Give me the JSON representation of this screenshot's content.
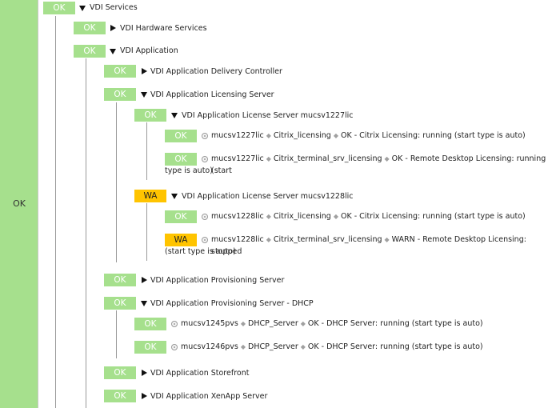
{
  "root": {
    "status": "OK"
  },
  "services": {
    "status": "OK",
    "label": "VDI Services",
    "hardware": {
      "status": "OK",
      "label": "VDI Hardware Services"
    },
    "application": {
      "status": "OK",
      "label": "VDI Application",
      "delivery_controller": {
        "status": "OK",
        "label": "VDI Application Delivery Controller"
      },
      "licensing": {
        "status": "OK",
        "label": "VDI Application Licensing Server",
        "server1": {
          "status": "OK",
          "label": "VDI Application License Server mucsv1227lic",
          "checks": [
            {
              "status": "OK",
              "host": "mucsv1227lic",
              "service": "Citrix_licensing",
              "text": "OK - Citrix Licensing: running (start type is auto)"
            },
            {
              "status": "OK",
              "host": "mucsv1227lic",
              "service": "Citrix_terminal_srv_licensing",
              "text": "OK - Remote Desktop Licensing: running (start",
              "text_cont": "type is auto)"
            }
          ]
        },
        "server2": {
          "status": "WA",
          "label": "VDI Application License Server mucsv1228lic",
          "checks": [
            {
              "status": "OK",
              "host": "mucsv1228lic",
              "service": "Citrix_licensing",
              "text": "OK - Citrix Licensing: running (start type is auto)"
            },
            {
              "status": "WA",
              "host": "mucsv1228lic",
              "service": "Citrix_terminal_srv_licensing",
              "text": "WARN - Remote Desktop Licensing: stopped",
              "text_cont": "(start type is auto)"
            }
          ]
        }
      },
      "provisioning": {
        "status": "OK",
        "label": "VDI Application Provisioning Server"
      },
      "provisioning_dhcp": {
        "status": "OK",
        "label": "VDI Application Provisioning Server - DHCP",
        "checks": [
          {
            "status": "OK",
            "host": "mucsv1245pvs",
            "service": "DHCP_Server",
            "text": "OK - DHCP Server: running (start type is auto)"
          },
          {
            "status": "OK",
            "host": "mucsv1246pvs",
            "service": "DHCP_Server",
            "text": "OK - DHCP Server: running (start type is auto)"
          }
        ]
      },
      "storefront": {
        "status": "OK",
        "label": "VDI Application Storefront"
      },
      "xenapp": {
        "status": "OK",
        "label": "VDI Application XenApp Server"
      }
    }
  }
}
